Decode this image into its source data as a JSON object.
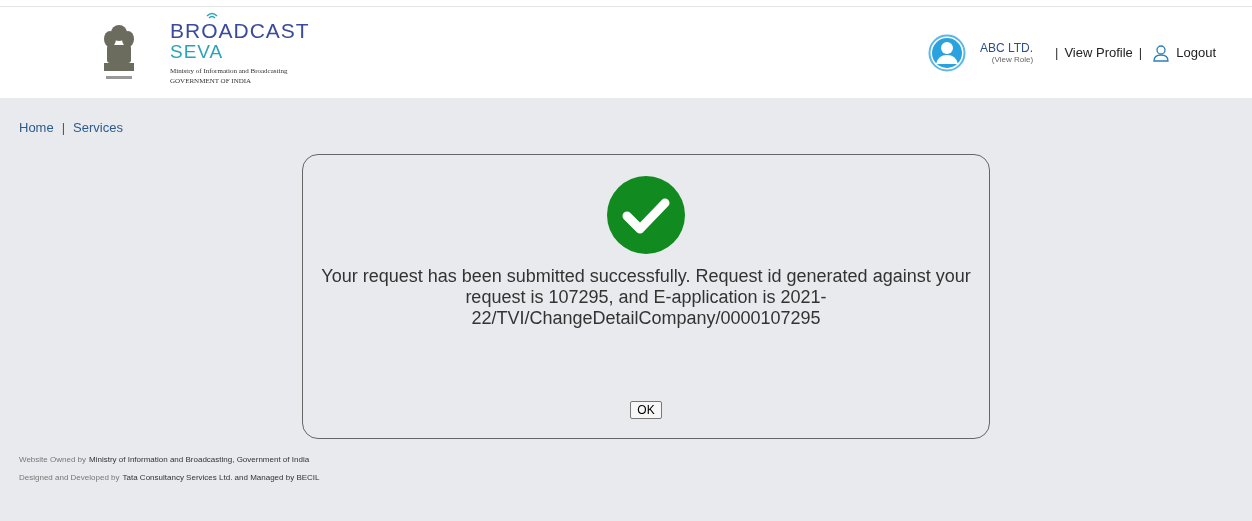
{
  "header": {
    "logo": {
      "line1": "BROADCAST",
      "line2": "SEVA",
      "ministry": "Ministry of Information and Broadcasting",
      "government": "GOVERNMENT OF INDIA"
    },
    "user": {
      "name": "ABC LTD.",
      "role": "(View Role)"
    },
    "links": [
      {
        "separator": "|",
        "label": "View Profile"
      },
      {
        "separator": "|",
        "label": "Logout"
      }
    ]
  },
  "breadcrumb": [
    {
      "label": "Home"
    },
    {
      "label": "Services"
    }
  ],
  "breadcrumb_separator": "|",
  "dialog": {
    "message": "Your request has been submitted successfully. Request id generated against your request is 107295, and E-application is 2021-22/TVI/ChangeDetailCompany/0000107295",
    "button": "OK"
  },
  "footer": [
    {
      "label": "Website Owned by",
      "value": "Ministry of Information and Broadcasting, Government of India"
    },
    {
      "label": "Designed and Developed by",
      "value": "Tata Consultancy Services Ltd. and Managed by BECIL"
    }
  ]
}
